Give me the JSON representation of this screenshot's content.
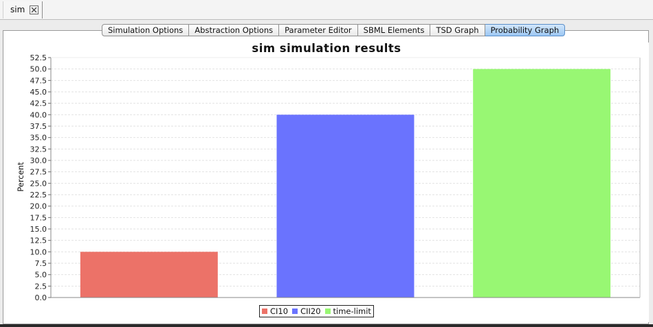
{
  "document_tab": {
    "label": "sim",
    "close_icon": "close-icon"
  },
  "subtabs": [
    {
      "label": "Simulation Options",
      "active": false
    },
    {
      "label": "Abstraction Options",
      "active": false
    },
    {
      "label": "Parameter Editor",
      "active": false
    },
    {
      "label": "SBML Elements",
      "active": false
    },
    {
      "label": "TSD Graph",
      "active": false
    },
    {
      "label": "Probability Graph",
      "active": true
    }
  ],
  "chart_data": {
    "type": "bar",
    "title": "sim simulation results",
    "xlabel": "",
    "ylabel": "Percent",
    "ylim": [
      0,
      52.5
    ],
    "yticks": [
      "0.0",
      "2.5",
      "5.0",
      "7.5",
      "10.0",
      "12.5",
      "15.0",
      "17.5",
      "20.0",
      "22.5",
      "25.0",
      "27.5",
      "30.0",
      "32.5",
      "35.0",
      "37.5",
      "40.0",
      "42.5",
      "45.0",
      "47.5",
      "50.0",
      "52.5"
    ],
    "grid": true,
    "legend_position": "bottom",
    "series": [
      {
        "name": "CI10",
        "value": 10,
        "color": "#ec7268"
      },
      {
        "name": "CII20",
        "value": 40,
        "color": "#6a73fe"
      },
      {
        "name": "time-limit",
        "value": 50,
        "color": "#98f773"
      }
    ]
  }
}
